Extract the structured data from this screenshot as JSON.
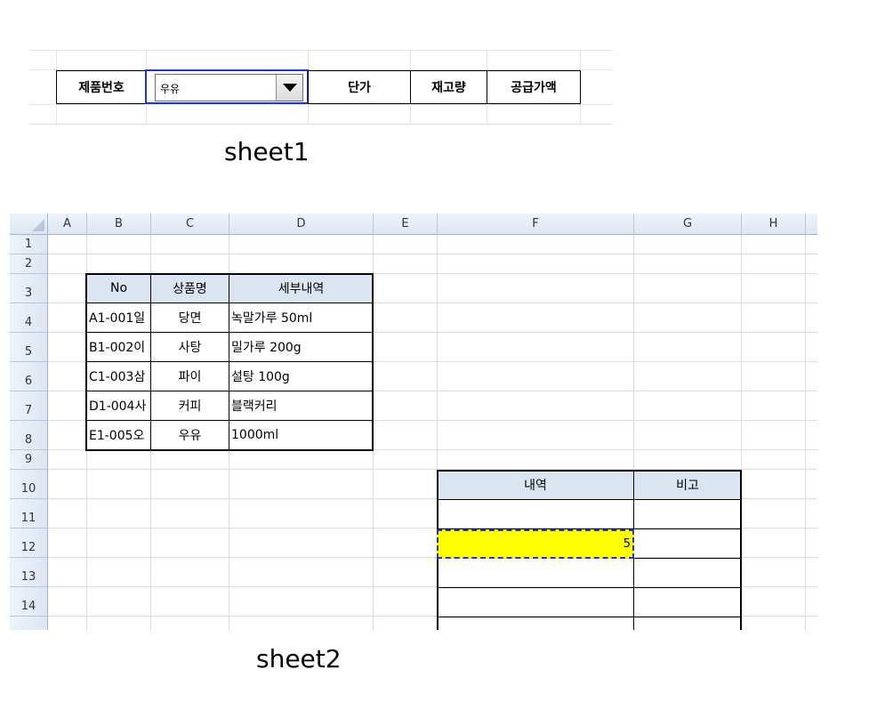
{
  "sheet1": {
    "headers": [
      "제품번호",
      "단가",
      "재고량",
      "공급가액"
    ],
    "dropdown": {
      "value": "우유"
    },
    "caption": "sheet1"
  },
  "sheet2": {
    "columns": [
      "A",
      "B",
      "C",
      "D",
      "E",
      "F",
      "G",
      "H"
    ],
    "rows": [
      "1",
      "2",
      "3",
      "4",
      "5",
      "6",
      "7",
      "8",
      "9",
      "10",
      "11",
      "12",
      "13",
      "14"
    ],
    "product_table": {
      "headers": [
        "No",
        "상품명",
        "세부내역"
      ],
      "rows": [
        [
          "A1-001일",
          "당면",
          "녹말가루 50ml"
        ],
        [
          "B1-002이",
          "사탕",
          "밀가루 200g"
        ],
        [
          "C1-003삼",
          "파이",
          "설탕 100g"
        ],
        [
          "D1-004사",
          "커피",
          "블랙커리"
        ],
        [
          "E1-005오",
          "우유",
          "1000ml"
        ]
      ]
    },
    "detail_table": {
      "headers": [
        "내역",
        "비고"
      ],
      "selected_value": "5"
    },
    "caption": "sheet2"
  },
  "colors": {
    "header_fill": "#dbe5f1",
    "selection_fill": "#ffff00",
    "selection_border": "#1f35d6"
  }
}
